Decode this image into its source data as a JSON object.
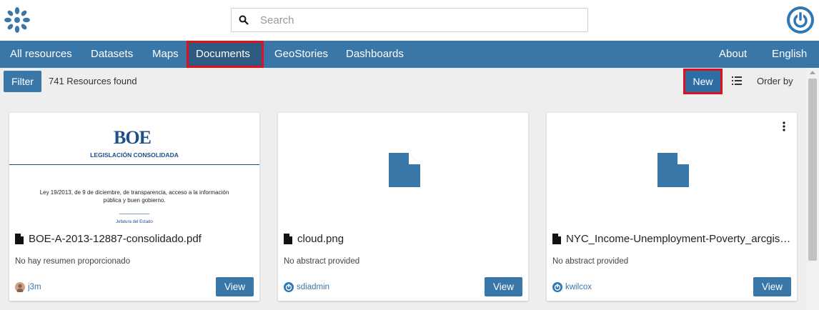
{
  "header": {
    "search_placeholder": "Search"
  },
  "nav": {
    "items": [
      "All resources",
      "Datasets",
      "Maps",
      "Documents",
      "GeoStories",
      "Dashboards"
    ],
    "active": "Documents",
    "right": [
      "About",
      "English"
    ]
  },
  "toolbar": {
    "filter_label": "Filter",
    "count_text": "741 Resources found",
    "new_label": "New",
    "order_label": "Order by"
  },
  "colors": {
    "primary": "#3a77a9",
    "highlight": "#e0101d"
  },
  "cards": [
    {
      "title": "BOE-A-2013-12887-consolidado.pdf",
      "abstract": "No hay resumen proporcionado",
      "user": "j3m",
      "view_label": "View",
      "preview": {
        "logo": "BOE",
        "heading": "LEGISLACIÓN CONSOLIDADA",
        "text": "Ley 19/2013, de 9 de diciembre, de transparencia, acceso a la información pública y buen gobierno.",
        "footer": "Jefatura del Estado"
      }
    },
    {
      "title": "cloud.png",
      "abstract": "No abstract provided",
      "user": "sdiadmin",
      "view_label": "View"
    },
    {
      "title": "NYC_Income-Unemployment-Poverty_arcgis.csv",
      "abstract": "No abstract provided",
      "user": "kwilcox",
      "view_label": "View"
    }
  ]
}
